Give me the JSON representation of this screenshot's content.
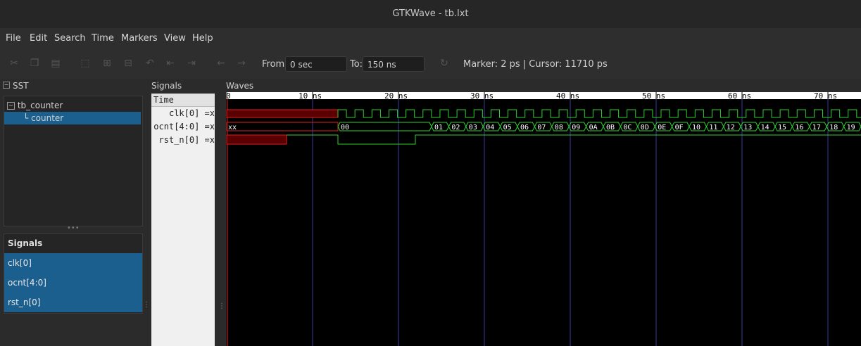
{
  "window": {
    "title": "GTKWave - tb.lxt"
  },
  "menu": [
    "File",
    "Edit",
    "Search",
    "Time",
    "Markers",
    "View",
    "Help"
  ],
  "toolbar": {
    "from_label": "From:",
    "from_value": "0 sec",
    "to_label": "To:",
    "to_value": "150 ns",
    "status": "Marker: 2 ps  |  Cursor: 11710 ps"
  },
  "sst": {
    "title": "SST",
    "tree": [
      {
        "label": "tb_counter"
      },
      {
        "label": "counter",
        "selected": true
      }
    ]
  },
  "signals_list": {
    "title": "Signals",
    "items": [
      "clk[0]",
      "ocnt[4:0]",
      "rst_n[0]"
    ]
  },
  "signals_panel": {
    "title": "Signals",
    "header": "Time",
    "rows": [
      "clk[0] =x",
      "ocnt[4:0] =x",
      "rst_n[0] =x"
    ]
  },
  "waves": {
    "title": "Waves",
    "time_labels": [
      "0",
      "10 ns",
      "20 ns",
      "30 ns",
      "40 ns",
      "50 ns",
      "60 ns",
      "70 ns"
    ],
    "ocnt_initial": "xx",
    "ocnt_values": [
      "00",
      "01",
      "02",
      "03",
      "04",
      "05",
      "06",
      "07",
      "08",
      "09",
      "0A",
      "0B",
      "0C",
      "0D",
      "0E",
      "0F",
      "10",
      "11",
      "12",
      "13",
      "14",
      "15",
      "16",
      "17",
      "18",
      "19"
    ]
  },
  "colors": {
    "wave_green": "#2fd12f",
    "wave_unknown": "#e02020",
    "cursor": "#ff2020",
    "grid": "#3a3aa0",
    "selection": "#1b5f8e"
  }
}
